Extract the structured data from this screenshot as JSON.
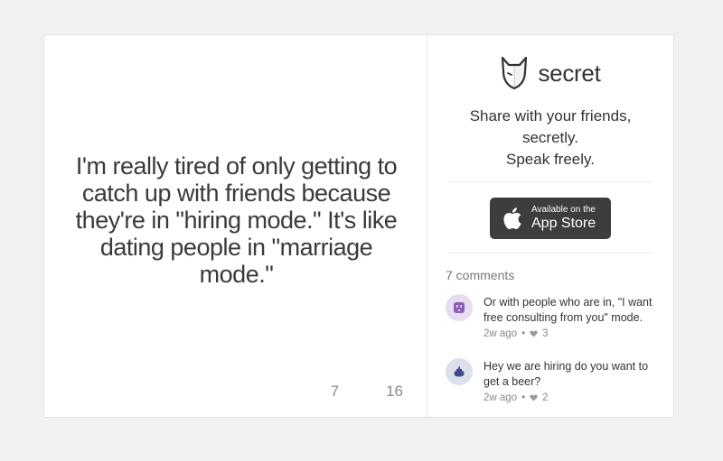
{
  "post": {
    "text": "I'm really tired of only getting to catch up with friends because they're in \"hiring mode.\" It's like dating people in \"marriage mode.\"",
    "count_left": "7",
    "count_right": "16"
  },
  "brand": {
    "name": "secret",
    "tagline_line1": "Share with your friends, secretly.",
    "tagline_line2": "Speak freely."
  },
  "appstore": {
    "small": "Available on the",
    "big": "App Store"
  },
  "comments": {
    "count_label": "7 comments",
    "items": [
      {
        "text": "Or with people who are in, \"I want free consulting from you\" mode.",
        "time": "2w ago",
        "likes": "3",
        "avatar_icon": "plug-icon",
        "avatar_color": "#e6def0",
        "icon_color": "#8a5fb3"
      },
      {
        "text": "Hey we are hiring do you want to get a beer?",
        "time": "2w ago",
        "likes": "2",
        "avatar_icon": "poop-icon",
        "avatar_color": "#dde0ea",
        "icon_color": "#3f4e8a"
      }
    ]
  }
}
